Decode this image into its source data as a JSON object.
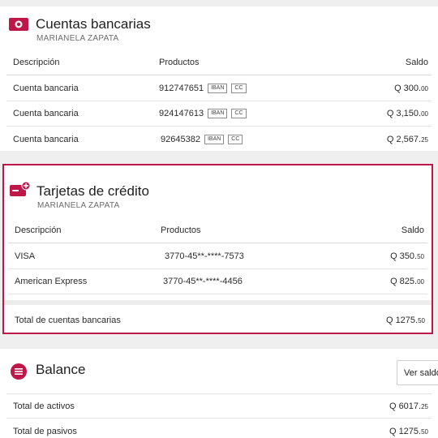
{
  "accounts": {
    "title": "Cuentas bancarias",
    "owner": "MARIANELA ZAPATA",
    "headers": {
      "description": "Descripción",
      "products": "Productos",
      "balance": "Saldo"
    },
    "rows": [
      {
        "description": "Cuenta bancaria",
        "product": "912747651",
        "tags": [
          "IBAN",
          "CC"
        ],
        "balance_main": "Q 300.",
        "balance_cents": "00"
      },
      {
        "description": "Cuenta bancaria",
        "product": "924147613",
        "tags": [
          "IBAN",
          "CC"
        ],
        "balance_main": "Q 3,150.",
        "balance_cents": "00"
      },
      {
        "description": "Cuenta bancaria",
        "product": "92645382",
        "tags": [
          "IBAN",
          "CC"
        ],
        "balance_main": "Q 2,567.",
        "balance_cents": "25"
      }
    ]
  },
  "cards": {
    "title": "Tarjetas de crédito",
    "owner": "MARIANELA ZAPATA",
    "headers": {
      "description": "Descripción",
      "products": "Productos",
      "balance": "Saldo"
    },
    "rows": [
      {
        "description": "VISA",
        "product": "3770-45**-****-7573",
        "balance_main": "Q 350.",
        "balance_cents": "50"
      },
      {
        "description": "American Express",
        "product": "3770-45**-****-4456",
        "balance_main": "Q 825.",
        "balance_cents": "00"
      }
    ],
    "total": {
      "label": "Total de cuentas bancarias",
      "value_main": "Q 1275.",
      "value_cents": "50"
    }
  },
  "balance": {
    "title": "Balance",
    "button_label": "Ver saldo",
    "rows": [
      {
        "label": "Total de activos",
        "value_main": "Q 6017.",
        "value_cents": "25"
      },
      {
        "label": "Total de pasivos",
        "value_main": "Q 1275.",
        "value_cents": "50"
      }
    ]
  },
  "colors": {
    "accent": "#c0174a",
    "text": "#2b2b2b",
    "muted": "#6a6a6a"
  },
  "icons": {
    "accounts": "bank-card-icon",
    "cards": "credit-card-plus-icon",
    "balance": "balance-list-icon"
  }
}
